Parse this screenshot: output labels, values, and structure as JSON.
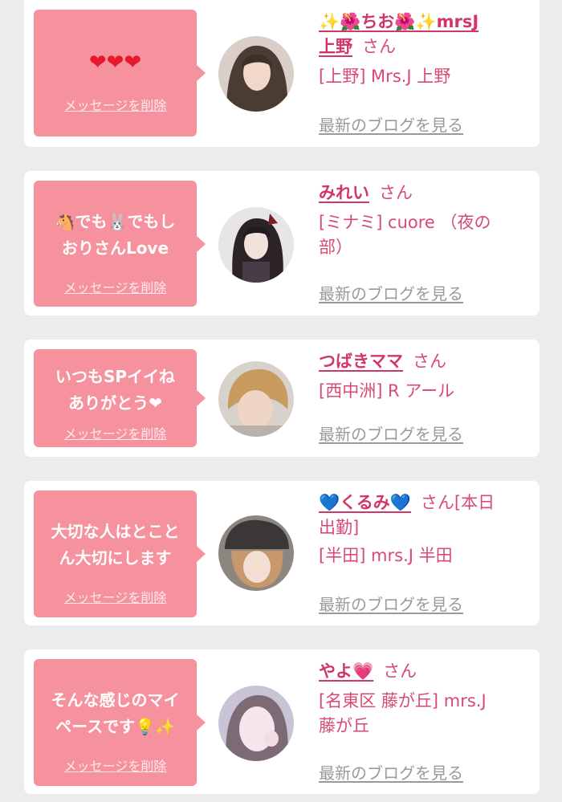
{
  "delete_label": "メッセージを削除",
  "blog_label": "最新のブログを見る",
  "san_label": "さん",
  "cards": [
    {
      "message": "❤❤❤",
      "name_pre": "✨",
      "name_mid1": "🌺",
      "name_text": "ちお",
      "name_mid2": "🌺",
      "name_post": "✨mrsJ",
      "name_line2": "上野",
      "shop": "[上野] Mrs.J 上野"
    },
    {
      "message_line1": "🐴でも🐰でもし",
      "message_line2": "おりさんLove",
      "name": "みれい",
      "shop_line1": "[ミナミ] cuore （夜の",
      "shop_line2": "部）"
    },
    {
      "message_line1": "いつもSPイイね",
      "message_line2": "ありがとう❤",
      "name": "つばきママ",
      "shop": "[西中洲] R アール"
    },
    {
      "message_line1": "大切な人はとこと",
      "message_line2": "ん大切にします",
      "name_pre": "💙",
      "name": "くるみ",
      "name_post": "💙",
      "san_suffix": "[本日",
      "san_line2": "出勤]",
      "shop": "[半田] mrs.J 半田"
    },
    {
      "message_line1": "そんな感じのマイ",
      "message_line2": "ペースです💡✨",
      "name": "やよ",
      "name_post": "💗",
      "shop_line1": "[名東区 藤が丘] mrs.J",
      "shop_line2": "藤が丘"
    }
  ]
}
